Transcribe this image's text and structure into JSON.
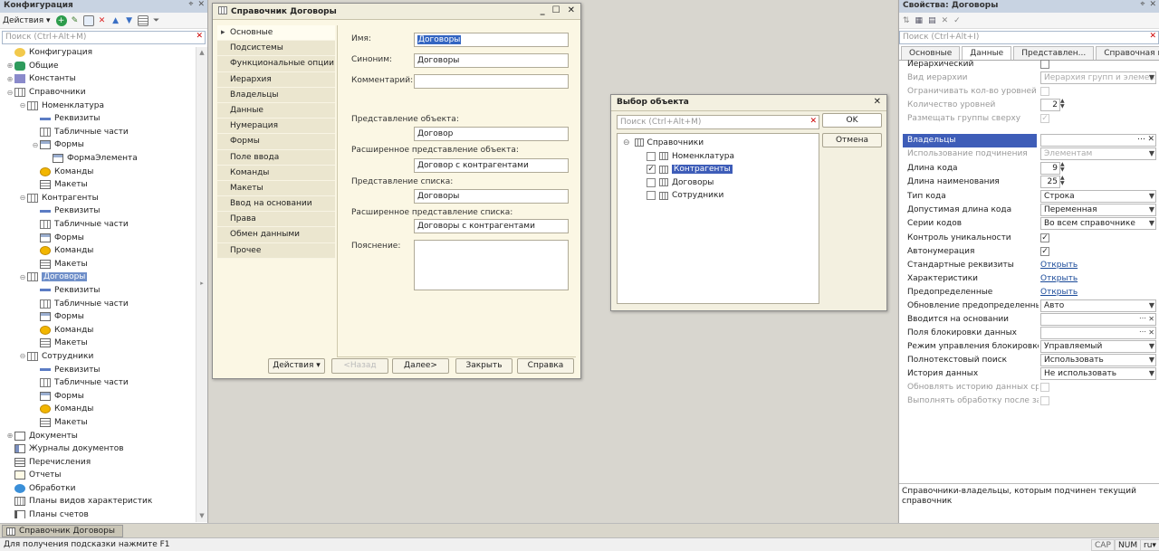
{
  "left_panel": {
    "title": "Конфигурация",
    "actions_label": "Действия",
    "search_placeholder": "Поиск (Ctrl+Alt+M)",
    "tree": [
      {
        "label": "Конфигурация",
        "level": 0,
        "icon": "cfg",
        "exp": ""
      },
      {
        "label": "Общие",
        "level": 0,
        "icon": "gen",
        "exp": "+"
      },
      {
        "label": "Константы",
        "level": 0,
        "icon": "const",
        "exp": "+"
      },
      {
        "label": "Справочники",
        "level": 0,
        "icon": "ref",
        "exp": "−"
      },
      {
        "label": "Номенклатура",
        "level": 1,
        "icon": "ref",
        "exp": "−"
      },
      {
        "label": "Реквизиты",
        "level": 2,
        "icon": "attr",
        "exp": ""
      },
      {
        "label": "Табличные части",
        "level": 2,
        "icon": "tab",
        "exp": ""
      },
      {
        "label": "Формы",
        "level": 2,
        "icon": "form",
        "exp": "−"
      },
      {
        "label": "ФормаЭлемента",
        "level": 3,
        "icon": "form",
        "exp": ""
      },
      {
        "label": "Команды",
        "level": 2,
        "icon": "cmd",
        "exp": ""
      },
      {
        "label": "Макеты",
        "level": 2,
        "icon": "mak",
        "exp": ""
      },
      {
        "label": "Контрагенты",
        "level": 1,
        "icon": "ref",
        "exp": "−"
      },
      {
        "label": "Реквизиты",
        "level": 2,
        "icon": "attr",
        "exp": ""
      },
      {
        "label": "Табличные части",
        "level": 2,
        "icon": "tab",
        "exp": ""
      },
      {
        "label": "Формы",
        "level": 2,
        "icon": "form",
        "exp": ""
      },
      {
        "label": "Команды",
        "level": 2,
        "icon": "cmd",
        "exp": ""
      },
      {
        "label": "Макеты",
        "level": 2,
        "icon": "mak",
        "exp": ""
      },
      {
        "label": "Договоры",
        "level": 1,
        "icon": "ref",
        "exp": "−",
        "selected": true
      },
      {
        "label": "Реквизиты",
        "level": 2,
        "icon": "attr",
        "exp": ""
      },
      {
        "label": "Табличные части",
        "level": 2,
        "icon": "tab",
        "exp": ""
      },
      {
        "label": "Формы",
        "level": 2,
        "icon": "form",
        "exp": ""
      },
      {
        "label": "Команды",
        "level": 2,
        "icon": "cmd",
        "exp": ""
      },
      {
        "label": "Макеты",
        "level": 2,
        "icon": "mak",
        "exp": ""
      },
      {
        "label": "Сотрудники",
        "level": 1,
        "icon": "ref",
        "exp": "−"
      },
      {
        "label": "Реквизиты",
        "level": 2,
        "icon": "attr",
        "exp": ""
      },
      {
        "label": "Табличные части",
        "level": 2,
        "icon": "tab",
        "exp": ""
      },
      {
        "label": "Формы",
        "level": 2,
        "icon": "form",
        "exp": ""
      },
      {
        "label": "Команды",
        "level": 2,
        "icon": "cmd",
        "exp": ""
      },
      {
        "label": "Макеты",
        "level": 2,
        "icon": "mak",
        "exp": ""
      },
      {
        "label": "Документы",
        "level": 0,
        "icon": "doc",
        "exp": "+"
      },
      {
        "label": "Журналы документов",
        "level": 0,
        "icon": "jrn",
        "exp": ""
      },
      {
        "label": "Перечисления",
        "level": 0,
        "icon": "enum",
        "exp": ""
      },
      {
        "label": "Отчеты",
        "level": 0,
        "icon": "rep",
        "exp": ""
      },
      {
        "label": "Обработки",
        "level": 0,
        "icon": "proc",
        "exp": ""
      },
      {
        "label": "Планы видов характеристик",
        "level": 0,
        "icon": "pvh",
        "exp": ""
      },
      {
        "label": "Планы счетов",
        "level": 0,
        "icon": "ps",
        "exp": ""
      }
    ]
  },
  "dict_window": {
    "title": "Справочник Договоры",
    "nav": [
      "Основные",
      "Подсистемы",
      "Функциональные опции",
      "Иерархия",
      "Владельцы",
      "Данные",
      "Нумерация",
      "Формы",
      "Поле ввода",
      "Команды",
      "Макеты",
      "Ввод на основании",
      "Права",
      "Обмен данными",
      "Прочее"
    ],
    "fields": {
      "name_label": "Имя:",
      "name_value": "Договоры",
      "synonym_label": "Синоним:",
      "synonym_value": "Договоры",
      "comment_label": "Комментарий:",
      "comment_value": "",
      "obj_repr_label": "Представление объекта:",
      "obj_repr_value": "Договор",
      "ext_obj_repr_label": "Расширенное представление объекта:",
      "ext_obj_repr_value": "Договор с контрагентами",
      "list_repr_label": "Представление списка:",
      "list_repr_value": "Договоры",
      "ext_list_repr_label": "Расширенное представление списка:",
      "ext_list_repr_value": "Договоры с контрагентами",
      "explanation_label": "Пояснение:"
    },
    "buttons": {
      "actions": "Действия",
      "back": "<Назад",
      "next": "Далее>",
      "close": "Закрыть",
      "help": "Справка"
    }
  },
  "select_window": {
    "title": "Выбор объекта",
    "search_placeholder": "Поиск (Ctrl+Alt+M)",
    "ok": "OK",
    "cancel": "Отмена",
    "root": "Справочники",
    "items": [
      {
        "label": "Номенклатура",
        "checked": false
      },
      {
        "label": "Контрагенты",
        "checked": true
      },
      {
        "label": "Договоры",
        "checked": false
      },
      {
        "label": "Сотрудники",
        "checked": false
      }
    ]
  },
  "right_panel": {
    "title": "Свойства: Договоры",
    "search_placeholder": "Поиск (Ctrl+Alt+I)",
    "tabs": [
      "Основные",
      "Данные",
      "Представлен...",
      "Справочная и..."
    ],
    "active_tab": 1,
    "props": {
      "hier_label": "Иерархический",
      "hier_kind_label": "Вид иерархии",
      "hier_kind_value": "Иерархия групп и элементов",
      "limit_levels_label": "Ограничивать кол-во уровней",
      "levels_count_label": "Количество уровней",
      "levels_count_value": "2",
      "groups_top_label": "Размещать группы сверху",
      "owners_label": "Владельцы",
      "subordination_label": "Использование подчинения",
      "subordination_value": "Элементам",
      "code_len_label": "Длина кода",
      "code_len_value": "9",
      "name_len_label": "Длина наименования",
      "name_len_value": "25",
      "code_type_label": "Тип кода",
      "code_type_value": "Строка",
      "code_allowed_len_label": "Допустимая длина кода",
      "code_allowed_len_value": "Переменная",
      "code_series_label": "Серии кодов",
      "code_series_value": "Во всем справочнике",
      "uniqueness_label": "Контроль уникальности",
      "autonumber_label": "Автонумерация",
      "std_attrs_label": "Стандартные реквизиты",
      "std_attrs_value": "Открыть",
      "characteristics_label": "Характеристики",
      "characteristics_value": "Открыть",
      "predefined_label": "Предопределенные",
      "predefined_value": "Открыть",
      "predef_update_label": "Обновление предопределенных д",
      "predef_update_value": "Авто",
      "based_on_label": "Вводится на основании",
      "based_on_value": "",
      "lock_fields_label": "Поля блокировки данных",
      "lock_fields_value": "",
      "lock_mode_label": "Режим управления блокировкой",
      "lock_mode_value": "Управляемый",
      "fulltext_label": "Полнотекстовый поиск",
      "fulltext_value": "Использовать",
      "history_label": "История данных",
      "history_value": "Не использовать",
      "history_update_label": "Обновлять историю данных сразу",
      "after_write_label": "Выполнять обработку после запи"
    },
    "hint": "Справочники-владельцы, которым подчинен текущий справочник"
  },
  "taskbar": {
    "task": "Справочник Договоры"
  },
  "status": {
    "text": "Для получения подсказки нажмите F1",
    "cap": "CAP",
    "num": "NUM",
    "lang": "ru"
  },
  "colors": {
    "selection": "#3e5db8",
    "window_bg": "#fbf7e4",
    "panel_title": "#c8d3e2"
  }
}
